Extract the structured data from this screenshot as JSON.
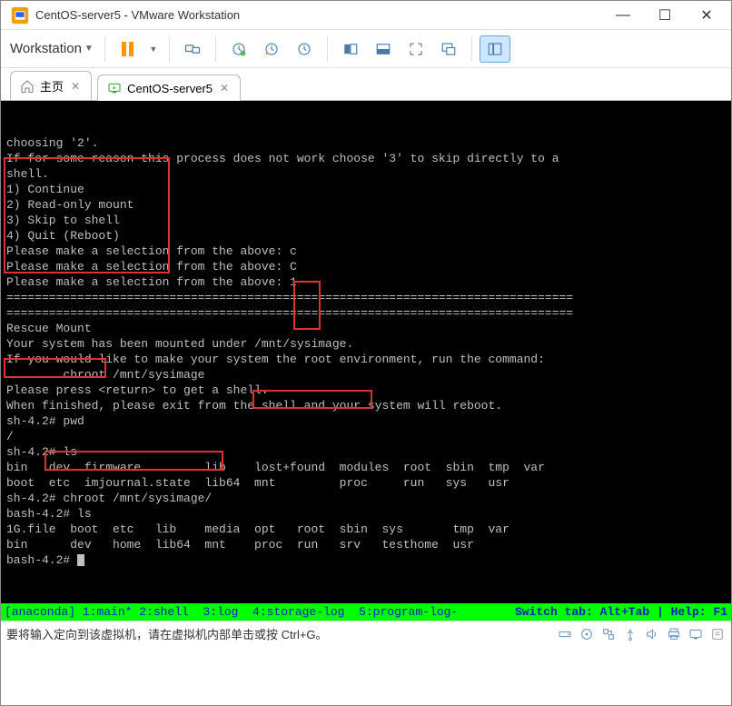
{
  "window": {
    "title": "CentOS-server5 - VMware Workstation",
    "controls": {
      "min": "—",
      "max": "☐",
      "close": "✕"
    }
  },
  "menu": {
    "label": "Workstation"
  },
  "tabs": {
    "home_label": "主页",
    "vm_label": "CentOS-server5"
  },
  "terminal": {
    "lines": [
      "choosing '2'.",
      "If for some reason this process does not work choose '3' to skip directly to a",
      "shell.",
      "",
      "1) Continue",
      "",
      "2) Read-only mount",
      "",
      "3) Skip to shell",
      "",
      "4) Quit (Reboot)",
      "",
      "Please make a selection from the above: c",
      "Please make a selection from the above: C",
      "Please make a selection from the above: 1",
      "================================================================================",
      "================================================================================",
      "Rescue Mount",
      "",
      "Your system has been mounted under /mnt/sysimage.",
      "",
      "If you would like to make your system the root environment, run the command:",
      "",
      "\tchroot /mnt/sysimage",
      "",
      "Please press <return> to get a shell.",
      "When finished, please exit from the shell and your system will reboot.",
      "sh-4.2# pwd",
      "/",
      "sh-4.2# ls",
      "bin   dev  firmware         lib    lost+found  modules  root  sbin  tmp  var",
      "boot  etc  imjournal.state  lib64  mnt         proc     run   sys   usr",
      "sh-4.2# chroot /mnt/sysimage/",
      "bash-4.2# ls",
      "1G.file  boot  etc   lib    media  opt   root  sbin  sys       tmp  var",
      "bin      dev   home  lib64  mnt    proc  run   srv   testhome  usr",
      "bash-4.2# "
    ]
  },
  "status_line": {
    "left": "[anaconda] 1:main* 2:shell  3:log  4:storage-log  5:program-log-",
    "right": "Switch tab: Alt+Tab | Help: F1"
  },
  "statusbar": {
    "message": "要将输入定向到该虚拟机，请在虚拟机内部单击或按 Ctrl+G。"
  }
}
